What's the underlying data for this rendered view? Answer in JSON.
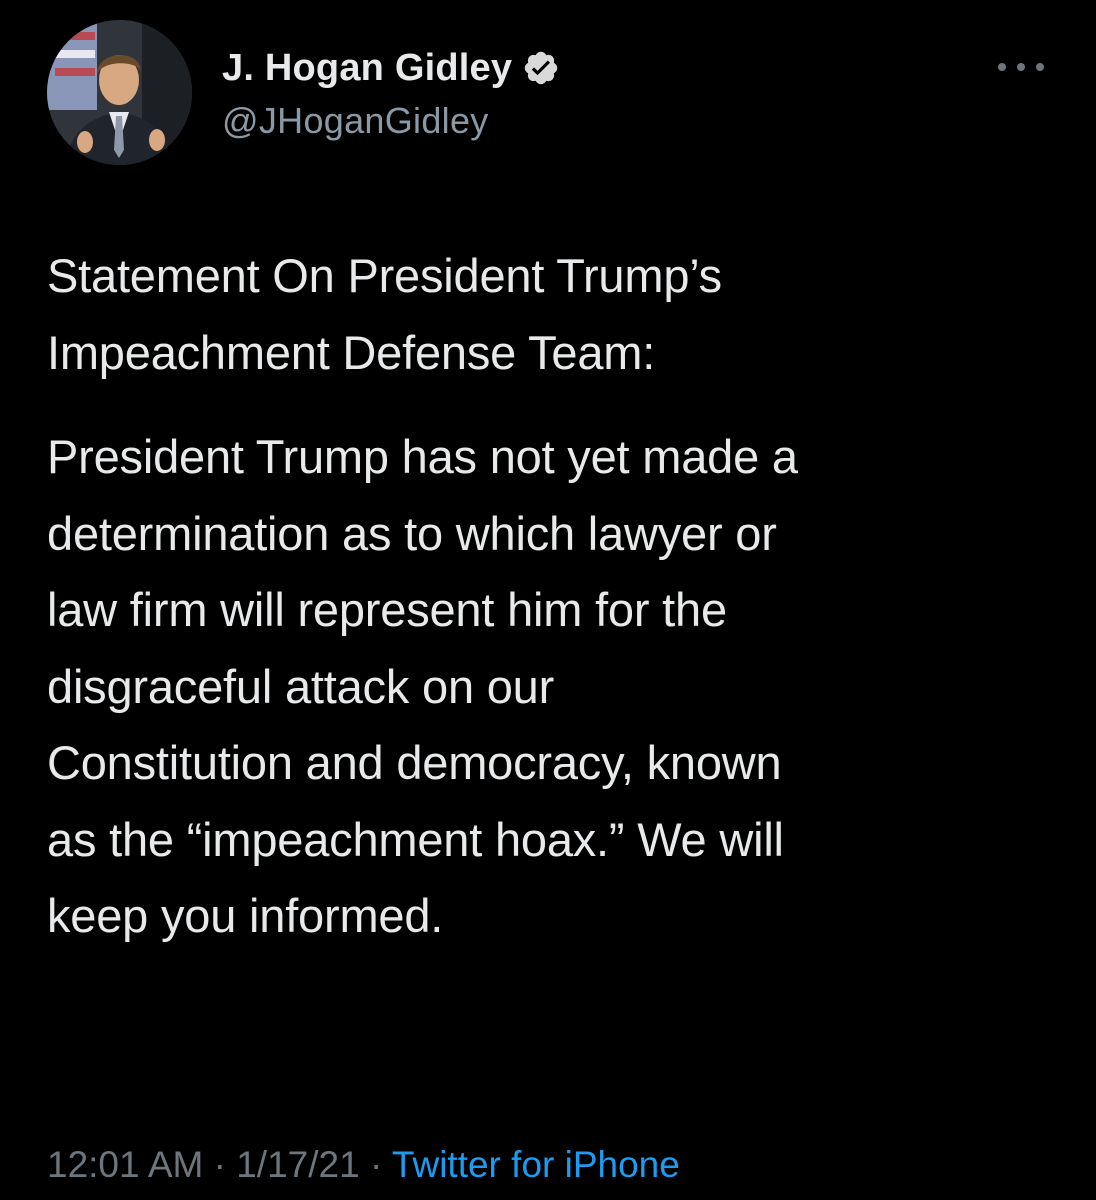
{
  "tweet": {
    "author": {
      "display_name": "J. Hogan Gidley",
      "handle": "@JHoganGidley",
      "verified_icon": "verified-badge-icon",
      "avatar": "profile-photo"
    },
    "menu_icon": "more-options-icon",
    "paragraphs": [
      "Statement On President Trump’s\nImpeachment Defense Team:",
      "President Trump has not yet made a\ndetermination as to which lawyer or\nlaw firm will represent him for the\ndisgraceful attack on our\nConstitution and democracy, known\nas the “impeachment hoax.” We will\nkeep you informed."
    ],
    "meta": {
      "time": "12:01 AM",
      "separator": "·",
      "date": "1/17/21",
      "source": "Twitter for iPhone"
    }
  },
  "colors": {
    "background": "#000000",
    "text_primary": "#e7e9ea",
    "text_secondary": "#6e767d",
    "link": "#1d9bf0",
    "verified_fill": "#d9d9d9"
  }
}
